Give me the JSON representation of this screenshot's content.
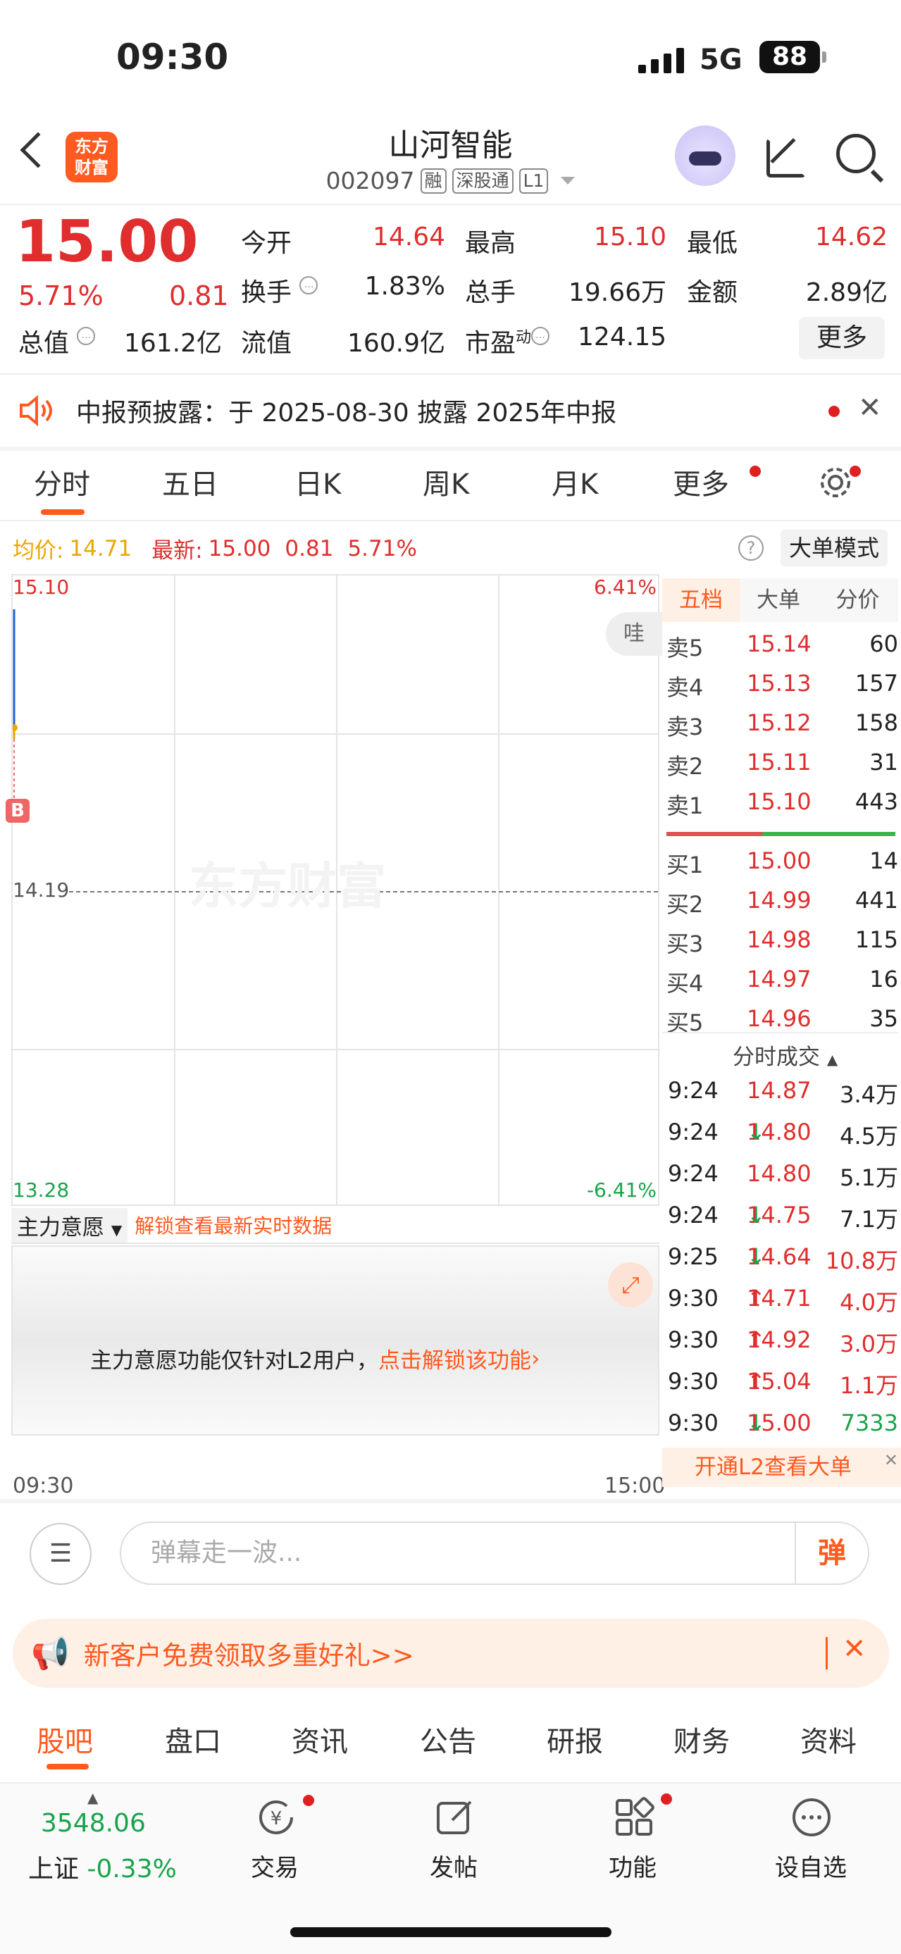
{
  "status": {
    "time": "09:30",
    "network": "5G",
    "battery": "88"
  },
  "header": {
    "logo_line1": "东方",
    "logo_line2": "财富",
    "title": "山河智能",
    "code": "002097",
    "tags": [
      "融",
      "深股通",
      "L1"
    ],
    "icons": [
      "back-icon",
      "robot-avatar-icon",
      "share-icon",
      "search-icon"
    ]
  },
  "quote": {
    "price": "15.00",
    "change_pct": "5.71%",
    "change": "0.81",
    "fields": [
      {
        "label": "今开",
        "value": "14.64",
        "color": "red"
      },
      {
        "label": "最高",
        "value": "15.10",
        "color": "red"
      },
      {
        "label": "最低",
        "value": "14.62",
        "color": "red"
      },
      {
        "label": "换手",
        "value": "1.83%",
        "color": "black"
      },
      {
        "label": "总手",
        "value": "19.66万",
        "color": "black"
      },
      {
        "label": "金额",
        "value": "2.89亿",
        "color": "black"
      },
      {
        "label": "总值",
        "value": "161.2亿",
        "color": "black"
      },
      {
        "label": "流值",
        "value": "160.9亿",
        "color": "black"
      },
      {
        "label": "市盈",
        "sup": "动",
        "value": "124.15",
        "color": "black"
      }
    ],
    "more": "更多"
  },
  "notice": {
    "text": "中报预披露：于 2025-08-30 披露 2025年中报"
  },
  "tabs": [
    "分时",
    "五日",
    "日K",
    "周K",
    "月K",
    "更多"
  ],
  "chart_bar": {
    "avg_label": "均价:",
    "avg_value": "14.71",
    "latest_label": "最新:",
    "latest_value": "15.00",
    "latest_change": "0.81",
    "latest_pct": "5.71%",
    "mode_button": "大单模式",
    "help": "?"
  },
  "chart": {
    "y_top": "15.10",
    "y_mid": "14.19",
    "y_bottom": "13.28",
    "pct_top": "6.41%",
    "pct_bottom": "-6.41%",
    "time_start": "09:30",
    "time_end": "15:00",
    "watermark": "东方财富",
    "bubble": "哇",
    "marker": "B"
  },
  "indicator": {
    "name": "主力意愿",
    "unlock_hint": "解锁查看最新实时数据",
    "body_text": "主力意愿功能仅针对L2用户，",
    "body_link": "点击解锁该功能"
  },
  "orderbook": {
    "tabs": [
      "五档",
      "大单",
      "分价"
    ],
    "asks": [
      {
        "label": "卖5",
        "price": "15.14",
        "vol": "60"
      },
      {
        "label": "卖4",
        "price": "15.13",
        "vol": "157"
      },
      {
        "label": "卖3",
        "price": "15.12",
        "vol": "158"
      },
      {
        "label": "卖2",
        "price": "15.11",
        "vol": "31"
      },
      {
        "label": "卖1",
        "price": "15.10",
        "vol": "443"
      }
    ],
    "bids": [
      {
        "label": "买1",
        "price": "15.00",
        "vol": "14"
      },
      {
        "label": "买2",
        "price": "14.99",
        "vol": "441"
      },
      {
        "label": "买3",
        "price": "14.98",
        "vol": "115"
      },
      {
        "label": "买4",
        "price": "14.97",
        "vol": "16"
      },
      {
        "label": "买5",
        "price": "14.96",
        "vol": "35"
      }
    ],
    "ticks_title": "分时成交",
    "ticks": [
      {
        "time": "9:24",
        "price": "14.87",
        "arrow": "",
        "vol": "3.4万",
        "vcolor": "black"
      },
      {
        "time": "9:24",
        "price": "14.80",
        "arrow": "↓",
        "vol": "4.5万",
        "vcolor": "black"
      },
      {
        "time": "9:24",
        "price": "14.80",
        "arrow": "",
        "vol": "5.1万",
        "vcolor": "black"
      },
      {
        "time": "9:24",
        "price": "14.75",
        "arrow": "↓",
        "vol": "7.1万",
        "vcolor": "black"
      },
      {
        "time": "9:25",
        "price": "14.64",
        "arrow": "↓",
        "vol": "10.8万",
        "vcolor": "red"
      },
      {
        "time": "9:30",
        "price": "14.71",
        "arrow": "↑",
        "vol": "4.0万",
        "vcolor": "red"
      },
      {
        "time": "9:30",
        "price": "14.92",
        "arrow": "↑",
        "vol": "3.0万",
        "vcolor": "red"
      },
      {
        "time": "9:30",
        "price": "15.04",
        "arrow": "↑",
        "vol": "1.1万",
        "vcolor": "red"
      },
      {
        "time": "9:30",
        "price": "15.00",
        "arrow": "↓",
        "vol": "7333",
        "vcolor": "green"
      }
    ],
    "l2_promo": "开通L2查看大单"
  },
  "danmu": {
    "placeholder": "弹幕走一波...",
    "send": "弹"
  },
  "banner": {
    "text": "新客户免费领取多重好礼>>"
  },
  "bottom_tabs": [
    "股吧",
    "盘口",
    "资讯",
    "公告",
    "研报",
    "财务",
    "资料"
  ],
  "nav": {
    "index_value": "3548.06",
    "index_name": "上证",
    "index_change": "-0.33%",
    "items": [
      "交易",
      "发帖",
      "功能",
      "设自选"
    ]
  },
  "colors": {
    "up": "#e02d2d",
    "down": "#19a34a",
    "accent": "#ff5a1f"
  }
}
